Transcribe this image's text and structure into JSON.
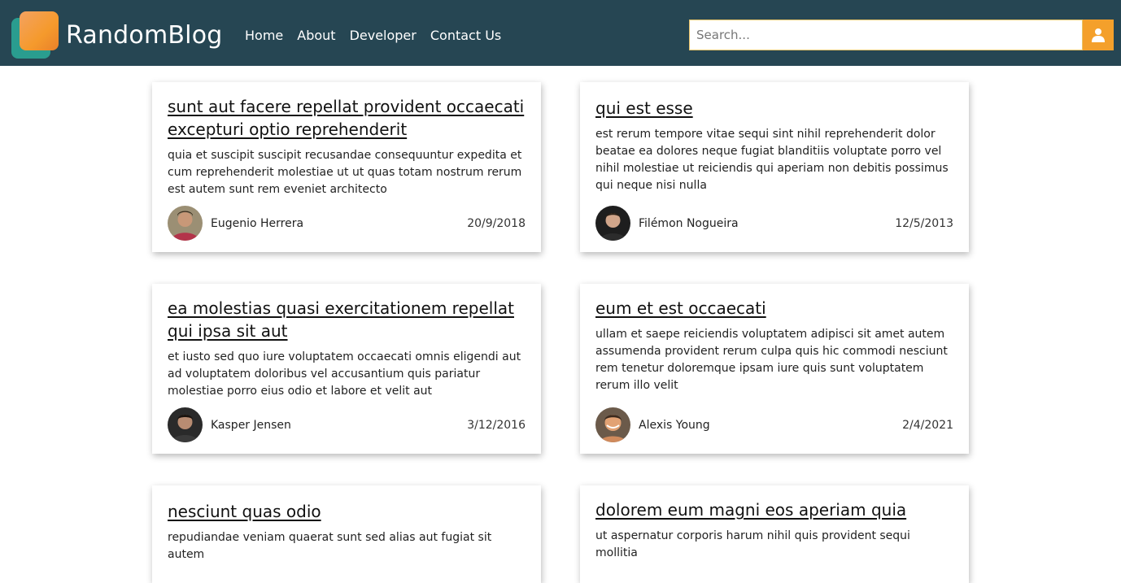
{
  "header": {
    "brand": "RandomBlog",
    "nav": [
      "Home",
      "About",
      "Developer",
      "Contact Us"
    ],
    "search_placeholder": "Search...",
    "user_icon": "user-icon",
    "colors": {
      "navbar": "#264653",
      "accent": "#f4a02b",
      "logo_front": "#f4a261",
      "logo_back": "#2a9d8f"
    }
  },
  "posts": [
    {
      "title": "sunt aut facere repellat provident occaecati excepturi optio reprehenderit",
      "body": "quia et suscipit suscipit recusandae consequuntur expedita et cum reprehenderit molestiae ut ut quas totam nostrum rerum est autem sunt rem eveniet architecto",
      "author": "Eugenio Herrera",
      "date": "20/9/2018"
    },
    {
      "title": "qui est esse",
      "body": "est rerum tempore vitae sequi sint nihil reprehenderit dolor beatae ea dolores neque fugiat blanditiis voluptate porro vel nihil molestiae ut reiciendis qui aperiam non debitis possimus qui neque nisi nulla",
      "author": "Filémon Nogueira",
      "date": "12/5/2013"
    },
    {
      "title": "ea molestias quasi exercitationem repellat qui ipsa sit aut",
      "body": "et iusto sed quo iure voluptatem occaecati omnis eligendi aut ad voluptatem doloribus vel accusantium quis pariatur molestiae porro eius odio et labore et velit aut",
      "author": "Kasper Jensen",
      "date": "3/12/2016"
    },
    {
      "title": "eum et est occaecati",
      "body": "ullam et saepe reiciendis voluptatem adipisci sit amet autem assumenda provident rerum culpa quis hic commodi nesciunt rem tenetur doloremque ipsam iure quis sunt voluptatem rerum illo velit",
      "author": "Alexis Young",
      "date": "2/4/2021"
    },
    {
      "title": "nesciunt quas odio",
      "body": "repudiandae veniam quaerat sunt sed alias aut fugiat sit autem",
      "author": "",
      "date": ""
    },
    {
      "title": "dolorem eum magni eos aperiam quia",
      "body": "ut aspernatur corporis harum nihil quis provident sequi mollitia",
      "author": "",
      "date": ""
    }
  ]
}
